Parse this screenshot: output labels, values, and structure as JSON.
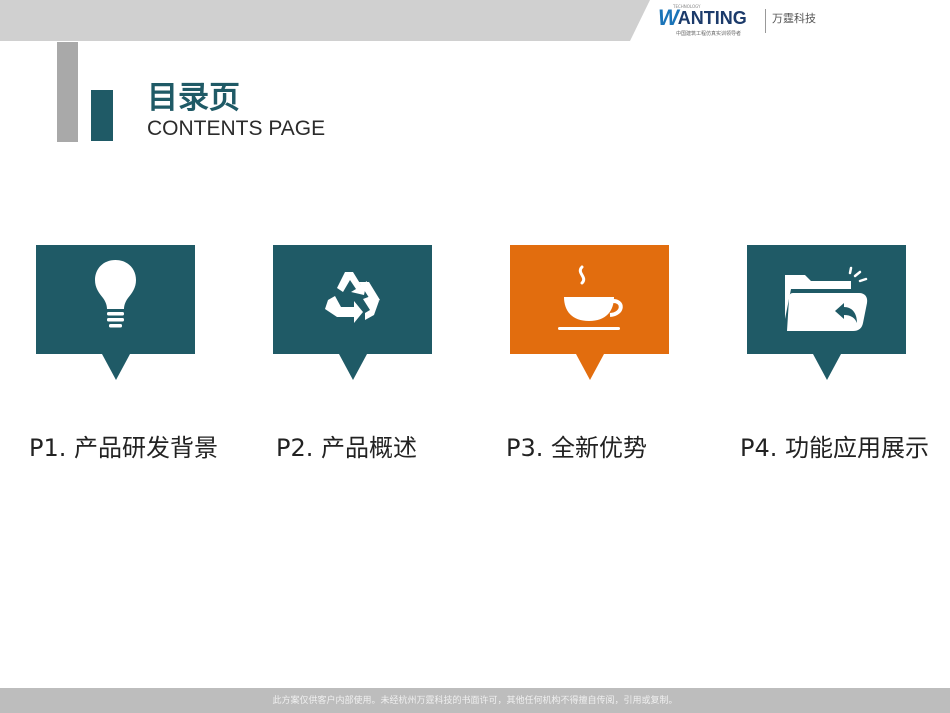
{
  "header": {
    "brand_logo": "WANTING",
    "brand_tech_tag": "TECHNOLOGY",
    "brand_tagline": "中国建筑工程仿真实训领导者",
    "brand_cn": "万霆科技"
  },
  "title": {
    "cn": "目录页",
    "en": "CONTENTS PAGE"
  },
  "sections": [
    {
      "label": "P1. 产品研发背景",
      "icon": "lightbulb-icon",
      "color": "#1f5a66"
    },
    {
      "label": "P2. 产品概述",
      "icon": "recycle-icon",
      "color": "#1f5a66"
    },
    {
      "label": "P3.  全新优势",
      "icon": "coffee-cup-icon",
      "color": "#e26d0e"
    },
    {
      "label": "P4. 功能应用展示",
      "icon": "folder-icon",
      "color": "#1f5a66"
    }
  ],
  "footer": {
    "notice": "此方案仅供客户内部使用。未经杭州万霆科技的书面许可，其他任何机构不得擅自传阅，引用或复制。"
  },
  "colors": {
    "teal": "#1f5a66",
    "orange": "#e26d0e",
    "gray_bar": "#a9a9a9"
  }
}
